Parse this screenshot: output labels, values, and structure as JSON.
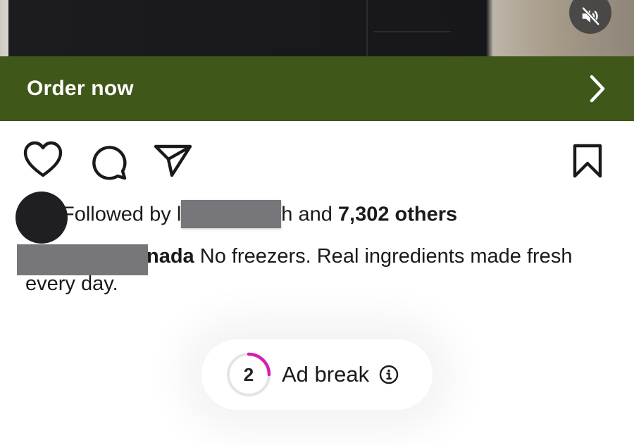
{
  "media": {
    "mute_icon": "speaker-muted-icon"
  },
  "order_bar": {
    "label": "Order now",
    "icon": "chevron-right-icon",
    "color": "#3f5718"
  },
  "actions": {
    "like_icon": "heart-icon",
    "comment_icon": "comment-icon",
    "share_icon": "send-icon",
    "save_icon": "bookmark-icon"
  },
  "likes": {
    "prefix": "Followed by ",
    "first_visible": "l",
    "last_visible": "h",
    "middle": " and ",
    "count": "7,302 others"
  },
  "caption": {
    "user_tail": "nada",
    "text": " No freezers. Real ingredients made fresh every day."
  },
  "ad_break": {
    "countdown": "2",
    "label": "Ad break",
    "progress": 0.25,
    "accent": "#d21fb4",
    "info_icon": "info-icon"
  }
}
